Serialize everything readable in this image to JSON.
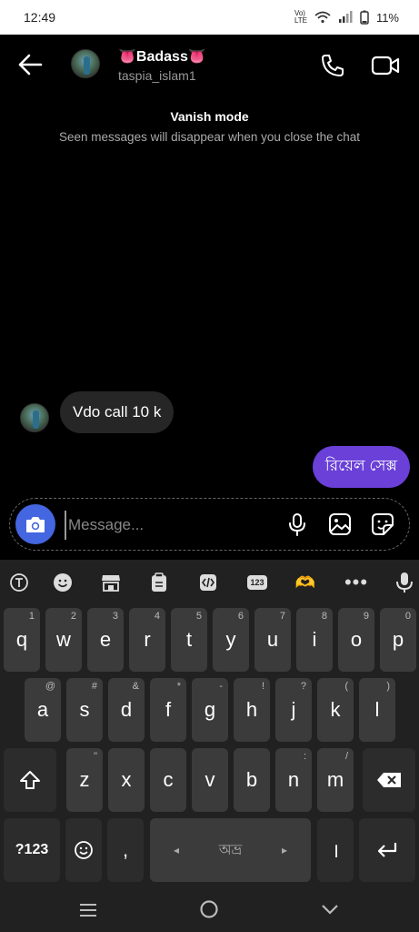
{
  "status": {
    "time": "12:49",
    "battery": "11%",
    "network": "Vo) LTE"
  },
  "header": {
    "name": "👅Badass👅",
    "username": "taspia_islam1"
  },
  "vanish": {
    "title": "Vanish mode",
    "subtitle": "Seen messages will disappear when you close the chat"
  },
  "messages": {
    "incoming": "Vdo call 10 k",
    "outgoing": "রিয়েল সেক্স"
  },
  "composer": {
    "placeholder": "Message..."
  },
  "keyboard": {
    "toolbar": {
      "clipboard": "123",
      "sticker": "🫶"
    },
    "row1": [
      {
        "k": "q",
        "h": "1"
      },
      {
        "k": "w",
        "h": "2"
      },
      {
        "k": "e",
        "h": "3"
      },
      {
        "k": "r",
        "h": "4"
      },
      {
        "k": "t",
        "h": "5"
      },
      {
        "k": "y",
        "h": "6"
      },
      {
        "k": "u",
        "h": "7"
      },
      {
        "k": "i",
        "h": "8"
      },
      {
        "k": "o",
        "h": "9"
      },
      {
        "k": "p",
        "h": "0"
      }
    ],
    "row2": [
      {
        "k": "a",
        "h": "@"
      },
      {
        "k": "s",
        "h": "#"
      },
      {
        "k": "d",
        "h": "&"
      },
      {
        "k": "f",
        "h": "*"
      },
      {
        "k": "g",
        "h": "-"
      },
      {
        "k": "h",
        "h": "!"
      },
      {
        "k": "j",
        "h": "?"
      },
      {
        "k": "k",
        "h": "("
      },
      {
        "k": "l",
        "h": ")"
      }
    ],
    "row3": [
      {
        "k": "z",
        "h": "\""
      },
      {
        "k": "x",
        "h": ""
      },
      {
        "k": "c",
        "h": ""
      },
      {
        "k": "v",
        "h": ""
      },
      {
        "k": "b",
        "h": ""
      },
      {
        "k": "n",
        "h": ":"
      },
      {
        "k": "m",
        "h": "/"
      }
    ],
    "symbols_label": "?123",
    "comma": ",",
    "space_label": "অভ্র",
    "period": "।",
    "space_left": "◂",
    "space_right": "▸"
  }
}
